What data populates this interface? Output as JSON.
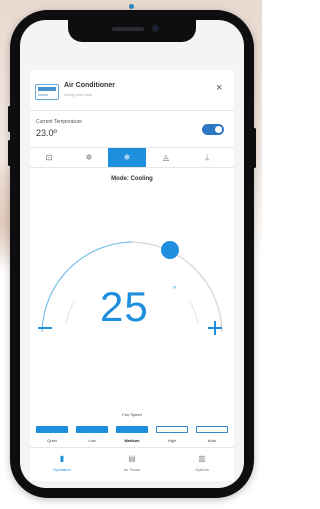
{
  "header": {
    "title": "Air Conditioner",
    "subtitle": "Living room unit",
    "logo_text": "SMART",
    "close_icon": "×"
  },
  "current": {
    "label": "Current Temperature",
    "value": "23.0º",
    "power_on": true
  },
  "modes": [
    {
      "icon": "auto-icon",
      "glyph": "⊡",
      "active": false
    },
    {
      "icon": "heat-icon",
      "glyph": "✲",
      "active": false
    },
    {
      "icon": "cool-icon",
      "glyph": "❄",
      "active": true
    },
    {
      "icon": "dry-icon",
      "glyph": "◬",
      "active": false
    },
    {
      "icon": "fan-icon",
      "glyph": "ᛦ",
      "active": false
    }
  ],
  "mode_label": "Mode: Cooling",
  "setpoint": {
    "value": "25",
    "unit": "°",
    "minus_label": "−",
    "plus_label": "+",
    "level": 0.5
  },
  "fan_speed": {
    "title": "Fan Speed",
    "options": [
      "Quiet",
      "Low",
      "Medium",
      "High",
      "Auto"
    ],
    "selected": "Medium"
  },
  "bottom_nav": [
    {
      "label": "Operation",
      "icon": "thermometer-icon",
      "glyph": "▮",
      "active": true
    },
    {
      "label": "Air Flows",
      "icon": "air-flow-icon",
      "glyph": "▤",
      "active": false
    },
    {
      "label": "Options",
      "icon": "options-icon",
      "glyph": "▥",
      "active": false
    }
  ],
  "colors": {
    "accent": "#1e8fdc",
    "frame": "#0e0e10"
  }
}
